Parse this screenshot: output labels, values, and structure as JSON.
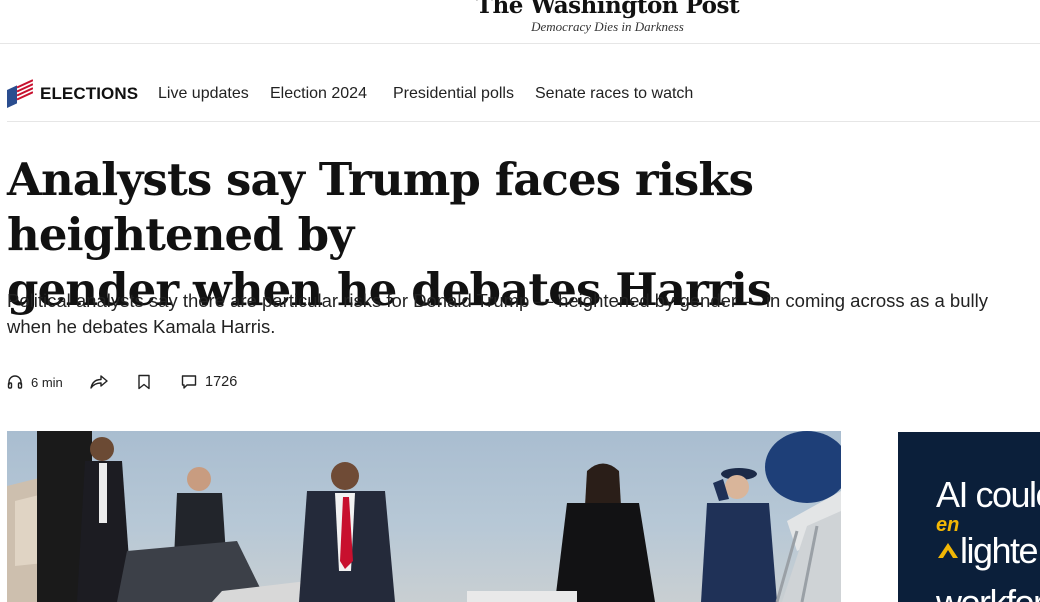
{
  "masthead": {
    "logo_text": "The Washington Post",
    "tagline": "Democracy Dies in Darkness"
  },
  "subnav": {
    "section_label": "ELECTIONS",
    "flag_icon": "flag-icon",
    "links": [
      "Live updates",
      "Election 2024",
      "Presidential polls",
      "Senate races to watch"
    ]
  },
  "article": {
    "headline_line1": "Analysts say Trump faces risks heightened by",
    "headline_line2": "gender when he debates Harris",
    "dek_line1": "Political analysts say there are particular risks for Donald Trump — heightened by gender — in coming across as a bully",
    "dek_line2": "when he debates Kamala Harris."
  },
  "tools": {
    "listen_icon": "headphones-icon",
    "listen_label": "6 min",
    "share_icon": "share-icon",
    "save_icon": "bookmark-icon",
    "comments_icon": "comment-icon",
    "comments_count": "1726"
  },
  "ad": {
    "line1": "AI coulc",
    "en": "en",
    "line2": "lighte",
    "line3": "workfor"
  },
  "colors": {
    "flag_blue": "#2a4d8f",
    "flag_red": "#c8102e",
    "ad_background": "#0b1f3a",
    "ad_accent": "#f2b705"
  }
}
